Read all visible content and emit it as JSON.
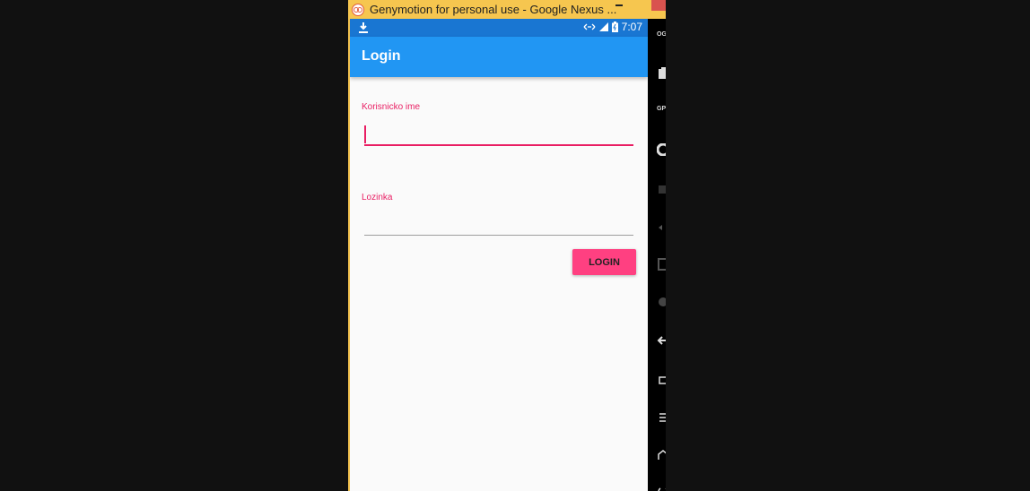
{
  "window": {
    "title": "Genymotion for personal use - Google Nexus ..."
  },
  "status_bar": {
    "time": "7:07"
  },
  "app_bar": {
    "title": "Login"
  },
  "form": {
    "username_label": "Korisnicko ime",
    "username_value": "",
    "password_label": "Lozinka",
    "password_value": "",
    "login_button": "LOGIN"
  },
  "side_toolbar": {
    "items": [
      {
        "label": "OG",
        "icon": "opengapps-icon"
      },
      {
        "label": "",
        "icon": "battery-icon"
      },
      {
        "label": "GPS",
        "icon": "gps-icon"
      },
      {
        "label": "",
        "icon": "camera-icon"
      },
      {
        "label": "",
        "icon": "remote-control-icon"
      },
      {
        "label": "",
        "icon": "volume-icon"
      },
      {
        "label": "",
        "icon": "id-icon"
      },
      {
        "label": "",
        "icon": "rotate-icon"
      },
      {
        "label": "",
        "icon": "back-icon"
      },
      {
        "label": "",
        "icon": "recent-apps-icon"
      },
      {
        "label": "",
        "icon": "menu-icon"
      },
      {
        "label": "",
        "icon": "home-icon"
      },
      {
        "label": "",
        "icon": "power-icon"
      }
    ]
  },
  "colors": {
    "app_bar": "#2196f3",
    "status_bar": "#1976d2",
    "accent": "#ff4081",
    "label": "#e91e63",
    "window_frame": "#f6c64f"
  }
}
